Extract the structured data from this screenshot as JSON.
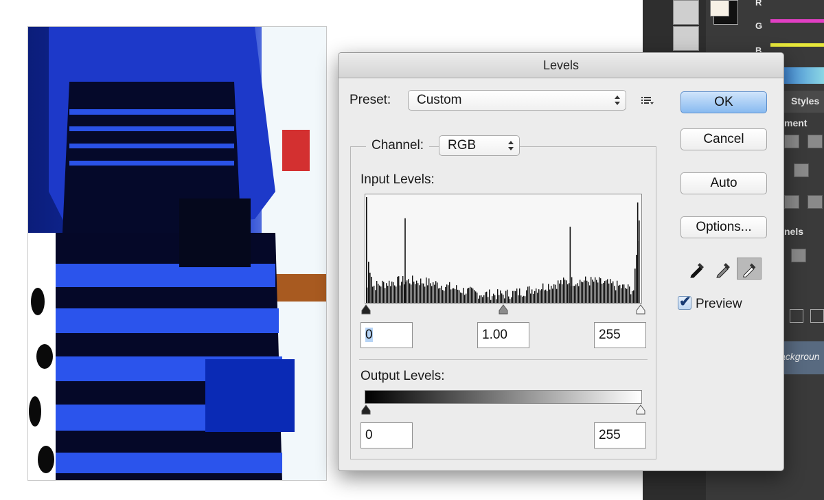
{
  "dialog": {
    "title": "Levels",
    "preset_label": "Preset:",
    "preset_value": "Custom",
    "channel_label": "Channel:",
    "channel_value": "RGB",
    "input_levels_label": "Input Levels:",
    "input_black": "0",
    "input_gamma": "1.00",
    "input_white": "255",
    "output_levels_label": "Output Levels:",
    "output_black": "0",
    "output_white": "255",
    "buttons": {
      "ok": "OK",
      "cancel": "Cancel",
      "auto": "Auto",
      "options": "Options..."
    },
    "preview_label": "Preview",
    "preview_checked": true
  },
  "histogram": {
    "channel": "RGB",
    "levels_range": [
      0,
      255
    ],
    "peaks": [
      {
        "level": 0,
        "relative_height": 1.0
      },
      {
        "level": 36,
        "relative_height": 0.8
      },
      {
        "level": 190,
        "relative_height": 0.72
      },
      {
        "level": 253,
        "relative_height": 0.95
      }
    ]
  },
  "ps_panel": {
    "channel_letters": [
      "R",
      "G",
      "B"
    ],
    "tab_styles": "Styles",
    "tab_adjustments_partial": "ment",
    "tab_channels_partial": "nels",
    "layer_name_partial": "ackgroun",
    "colors": {
      "r_slider": "#e23fc4",
      "g_slider": "#e8e83a",
      "accent": "#586a80"
    }
  },
  "icons": [
    "list-options-icon",
    "black-eyedropper-icon",
    "gray-eyedropper-icon",
    "white-eyedropper-icon",
    "checkbox-checked-icon"
  ]
}
